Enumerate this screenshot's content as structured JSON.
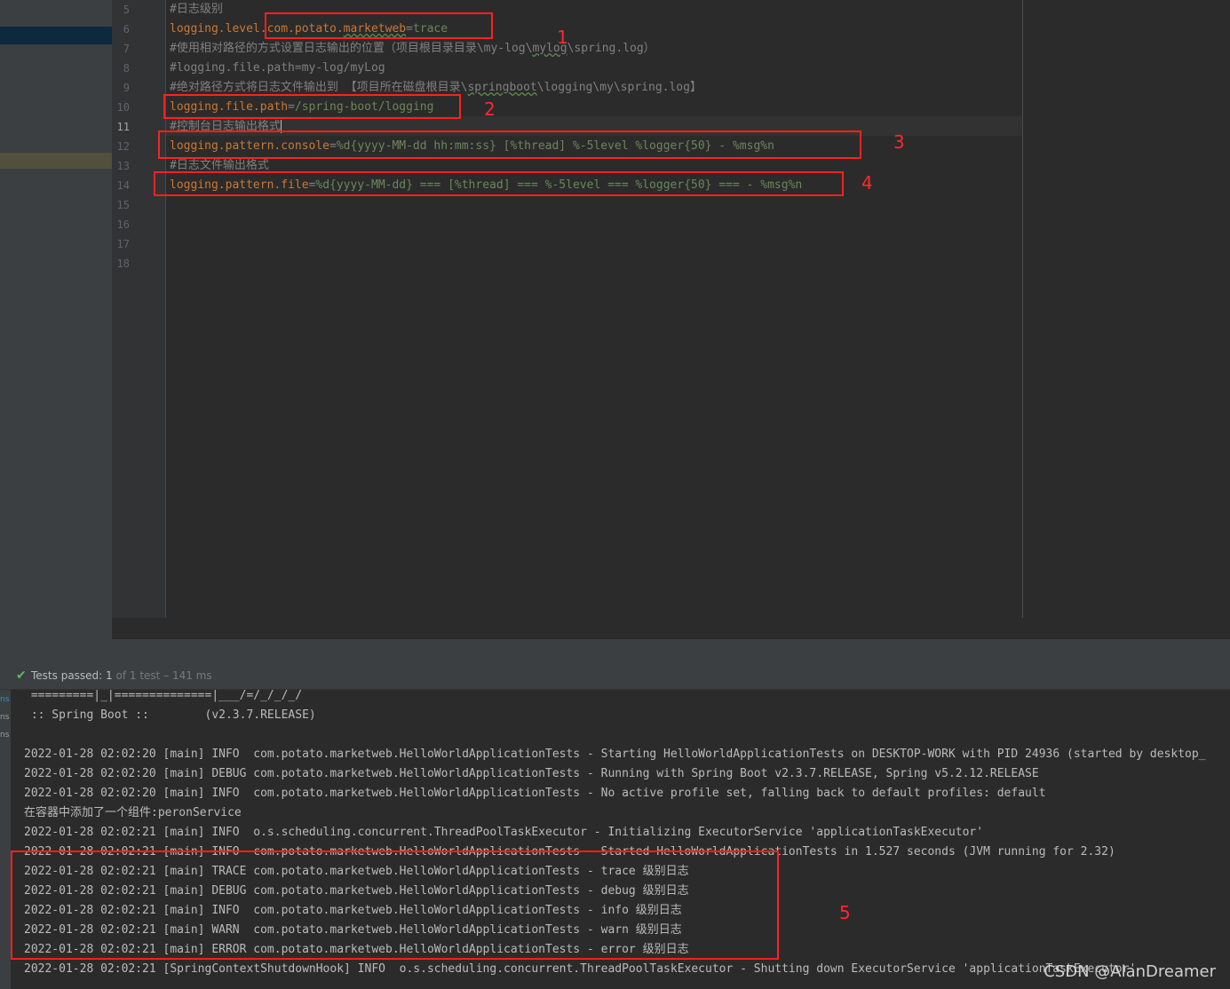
{
  "editor": {
    "line_numbers": [
      "5",
      "6",
      "7",
      "8",
      "9",
      "10",
      "11",
      "12",
      "13",
      "14",
      "15",
      "16",
      "17",
      "18"
    ],
    "lines": {
      "l5": "#日志级别",
      "l6_key": "logging.level.",
      "l6_pkg": "com.potato.",
      "l6_sq": "marketweb",
      "l6_eq": "=",
      "l6_val": "trace",
      "l7_a": "#使用相对路径的方式设置日志输出的位置（项目根目录目录\\my-log\\",
      "l7_sq": "mylog",
      "l7_b": "\\spring.log）",
      "l8": "#logging.file.path=my-log/myLog",
      "l9_a": "#绝对路径方式将日志文件输出到 【项目所在磁盘根目录\\",
      "l9_sq": "springboot",
      "l9_b": "\\logging\\my\\spring.log】",
      "l10_key": "logging.file.path",
      "l10_eq": "=",
      "l10_val": "/spring-boot/logging",
      "l11": "#控制台日志输出格式",
      "l12_key": "logging.pattern.console",
      "l12_eq": "=",
      "l12_val": "%d{yyyy-MM-dd hh:mm:ss} [%thread] %-5level %logger{50} - %msg%n",
      "l13": "#日志文件输出格式",
      "l14_key": "logging.pattern.file",
      "l14_eq": "=",
      "l14_val": "%d{yyyy-MM-dd} === [%thread] === %-5level === %logger{50} === - %msg%n"
    }
  },
  "annotations": [
    "1",
    "2",
    "3",
    "4",
    "5"
  ],
  "test_status": {
    "prefix": "Tests passed: ",
    "count": "1",
    "rest": " of 1 test – 141 ms"
  },
  "side_tabs": [
    "ns",
    "ns",
    "ns"
  ],
  "console_lines": [
    " =========|_|==============|___/=/_/_/_/",
    " :: Spring Boot ::        (v2.3.7.RELEASE)",
    "",
    "2022-01-28 02:02:20 [main] INFO  com.potato.marketweb.HelloWorldApplicationTests - Starting HelloWorldApplicationTests on DESKTOP-WORK with PID 24936 (started by desktop_",
    "2022-01-28 02:02:20 [main] DEBUG com.potato.marketweb.HelloWorldApplicationTests - Running with Spring Boot v2.3.7.RELEASE, Spring v5.2.12.RELEASE",
    "2022-01-28 02:02:20 [main] INFO  com.potato.marketweb.HelloWorldApplicationTests - No active profile set, falling back to default profiles: default",
    "在容器中添加了一个组件:peronService",
    "2022-01-28 02:02:21 [main] INFO  o.s.scheduling.concurrent.ThreadPoolTaskExecutor - Initializing ExecutorService 'applicationTaskExecutor'",
    "2022-01-28 02:02:21 [main] INFO  com.potato.marketweb.HelloWorldApplicationTests - Started HelloWorldApplicationTests in 1.527 seconds (JVM running for 2.32)",
    "2022-01-28 02:02:21 [main] TRACE com.potato.marketweb.HelloWorldApplicationTests - trace 级别日志",
    "2022-01-28 02:02:21 [main] DEBUG com.potato.marketweb.HelloWorldApplicationTests - debug 级别日志",
    "2022-01-28 02:02:21 [main] INFO  com.potato.marketweb.HelloWorldApplicationTests - info 级别日志",
    "2022-01-28 02:02:21 [main] WARN  com.potato.marketweb.HelloWorldApplicationTests - warn 级别日志",
    "2022-01-28 02:02:21 [main] ERROR com.potato.marketweb.HelloWorldApplicationTests - error 级别日志",
    "2022-01-28 02:02:21 [SpringContextShutdownHook] INFO  o.s.scheduling.concurrent.ThreadPoolTaskExecutor - Shutting down ExecutorService 'applicationTaskExecutor'"
  ],
  "watermark": "CSDN @AlanDreamer",
  "colors": {
    "annotation_red": "#ff2020",
    "pass_green": "#5fb85f",
    "comment": "#808080",
    "key": "#cc7832",
    "value": "#6a8759"
  }
}
